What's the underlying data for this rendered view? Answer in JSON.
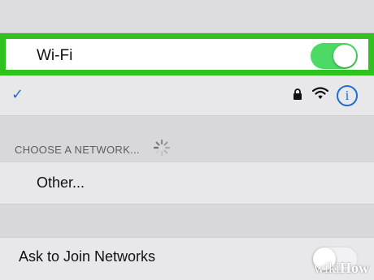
{
  "wifi": {
    "label": "Wi-Fi",
    "enabled": true,
    "highlight_color": "#2fc21e",
    "toggle_color": "#4cd964"
  },
  "connected_network": {
    "checkmark": "✓",
    "icons": [
      "lock-icon",
      "wifi-signal-icon",
      "info-icon"
    ],
    "info_glyph": "i"
  },
  "networks_section": {
    "header": "CHOOSE A NETWORK...",
    "loading": true
  },
  "other_row": {
    "label": "Other..."
  },
  "ask_to_join": {
    "label": "Ask to Join Networks",
    "enabled": false
  },
  "watermark": {
    "prefix": "wiki",
    "suffix": "How"
  }
}
